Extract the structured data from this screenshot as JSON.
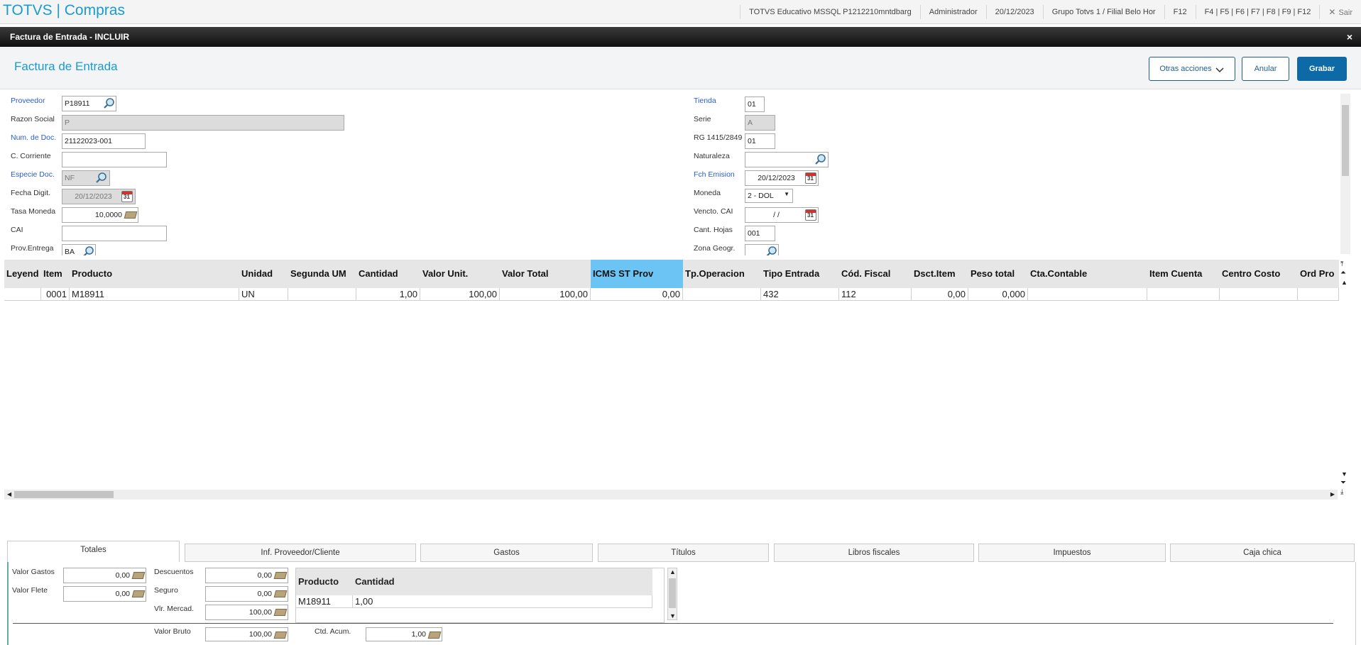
{
  "app": {
    "title": "TOTVS | Compras"
  },
  "topinfo": {
    "env": "TOTVS Educativo MSSQL P1212210mntdbarg",
    "user": "Administrador",
    "date": "20/12/2023",
    "branch": "Grupo Totvs 1 / Filial Belo Hor",
    "f12": "F12",
    "fkeys": "F4 | F5 | F6 | F7 | F8 | F9 | F12",
    "exit_icon": "✕",
    "exit": "Sair"
  },
  "dialog": {
    "title": "Factura de Entrada - INCLUIR",
    "close": "×"
  },
  "header": {
    "title": "Factura de Entrada",
    "more_actions": "Otras acciones",
    "cancel": "Anular",
    "save": "Grabar"
  },
  "form": {
    "proveedor": {
      "label": "Proveedor",
      "value": "P18911"
    },
    "razon_social": {
      "label": "Razon Social",
      "value": "P"
    },
    "num_doc": {
      "label": "Num. de Doc.",
      "value": "21122023-001"
    },
    "c_corriente": {
      "label": "C. Corriente",
      "value": ""
    },
    "especie_doc": {
      "label": "Especie Doc.",
      "value": "NF"
    },
    "fecha_digit": {
      "label": "Fecha Digit.",
      "value": "20/12/2023"
    },
    "tasa_moneda": {
      "label": "Tasa Moneda",
      "value": "10,0000"
    },
    "cai": {
      "label": "CAI",
      "value": ""
    },
    "prov_entrega": {
      "label": "Prov.Entrega",
      "value": "BA"
    },
    "tienda": {
      "label": "Tienda",
      "value": "01"
    },
    "serie": {
      "label": "Serie",
      "value": "A"
    },
    "rg": {
      "label": "RG 1415/2849",
      "value": "01"
    },
    "naturaleza": {
      "label": "Naturaleza",
      "value": ""
    },
    "fch_emision": {
      "label": "Fch Emision",
      "value": "20/12/2023"
    },
    "moneda": {
      "label": "Moneda",
      "value": "2 - DOL"
    },
    "vencto_cai": {
      "label": "Vencto. CAI",
      "value": " /  / "
    },
    "cant_hojas": {
      "label": "Cant. Hojas",
      "value": "001"
    },
    "zona_geogr": {
      "label": "Zona Geogr.",
      "value": ""
    }
  },
  "grid": {
    "columns": [
      "Leyend",
      "Item",
      "Producto",
      "Unidad",
      "Segunda UM",
      "Cantidad",
      "Valor Unit.",
      "Valor Total",
      "ICMS ST Prov",
      "Tp.Operacion",
      "Tipo Entrada",
      "Cód. Fiscal",
      "Dsct.Item",
      "Peso total",
      "Cta.Contable",
      "Item Cuenta",
      "Centro Costo",
      "Ord Pro"
    ],
    "rows": [
      [
        "",
        "0001",
        "M18911",
        "UN",
        "",
        "1,00",
        "100,00",
        "100,00",
        "0,00",
        "",
        "432",
        "112",
        "0,00",
        "0,000",
        "",
        "",
        "",
        ""
      ]
    ]
  },
  "tabs": [
    "Totales",
    "Inf. Proveedor/Cliente",
    "Gastos",
    "Títulos",
    "Libros fiscales",
    "Impuestos",
    "Caja chica"
  ],
  "totales": {
    "valor_gastos": {
      "label": "Valor Gastos",
      "value": "0,00"
    },
    "valor_flete": {
      "label": "Valor Flete",
      "value": "0,00"
    },
    "descuentos": {
      "label": "Descuentos",
      "value": "0,00"
    },
    "seguro": {
      "label": "Seguro",
      "value": "0,00"
    },
    "vlr_mercad": {
      "label": "Vlr. Mercad.",
      "value": "100,00"
    },
    "valor_bruto": {
      "label": "Valor Bruto",
      "value": "100,00"
    },
    "ctd_acum": {
      "label": "Ctd. Acum.",
      "value": "1,00"
    },
    "subgrid": {
      "columns": [
        "Producto",
        "Cantidad"
      ],
      "rows": [
        [
          "M18911",
          "1,00"
        ]
      ]
    }
  }
}
